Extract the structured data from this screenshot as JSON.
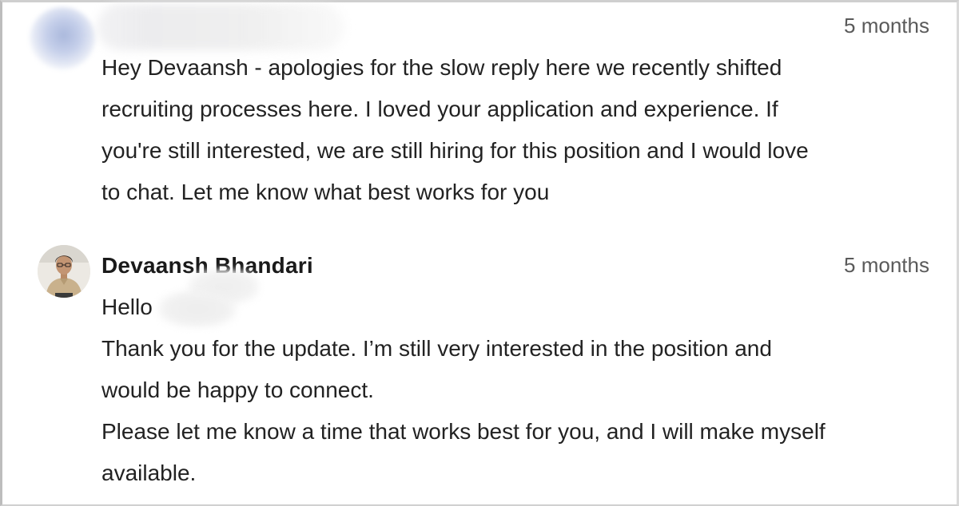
{
  "messages": [
    {
      "sender_name": "",
      "timestamp": "5 months",
      "body_lines": [
        "Hey Devaansh - apologies for the slow reply here we recently shifted",
        "recruiting processes here. I loved your application and experience. If",
        "you're still interested, we are still hiring for this position and I would love",
        "to chat. Let me know what best works for you"
      ]
    },
    {
      "sender_name": "Devaansh Bhandari",
      "timestamp": "5 months",
      "greeting": "Hello",
      "body_lines": [
        "Thank you for the update. I’m still very interested in the position and",
        "would be happy to connect.",
        "Please let me know a time that works best for you, and I will make myself",
        "available."
      ]
    }
  ],
  "icons": {
    "recruiter_avatar": "avatar-blurred",
    "user_avatar": "avatar-photo"
  },
  "colors": {
    "text": "#222222",
    "timestamp": "#5a5a5a",
    "border": "#cfcfcf"
  }
}
